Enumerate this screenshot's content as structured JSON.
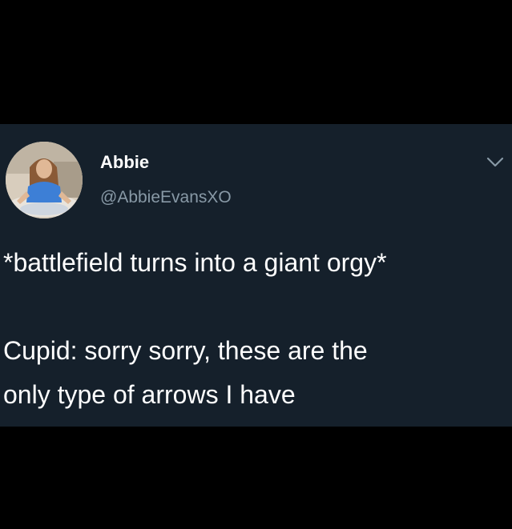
{
  "tweet": {
    "display_name": "Abbie",
    "handle": "@AbbieEvansXO",
    "text_line_1": "*battlefield turns into a giant orgy*",
    "text_line_2": "Cupid: sorry sorry, these are the",
    "text_line_3": "only type of arrows I have"
  },
  "icons": {
    "avatar": "profile-photo",
    "menu": "chevron-down-icon"
  },
  "colors": {
    "card_background": "#15202b",
    "page_background": "#000000",
    "primary_text": "#ffffff",
    "secondary_text": "#8899a6"
  }
}
